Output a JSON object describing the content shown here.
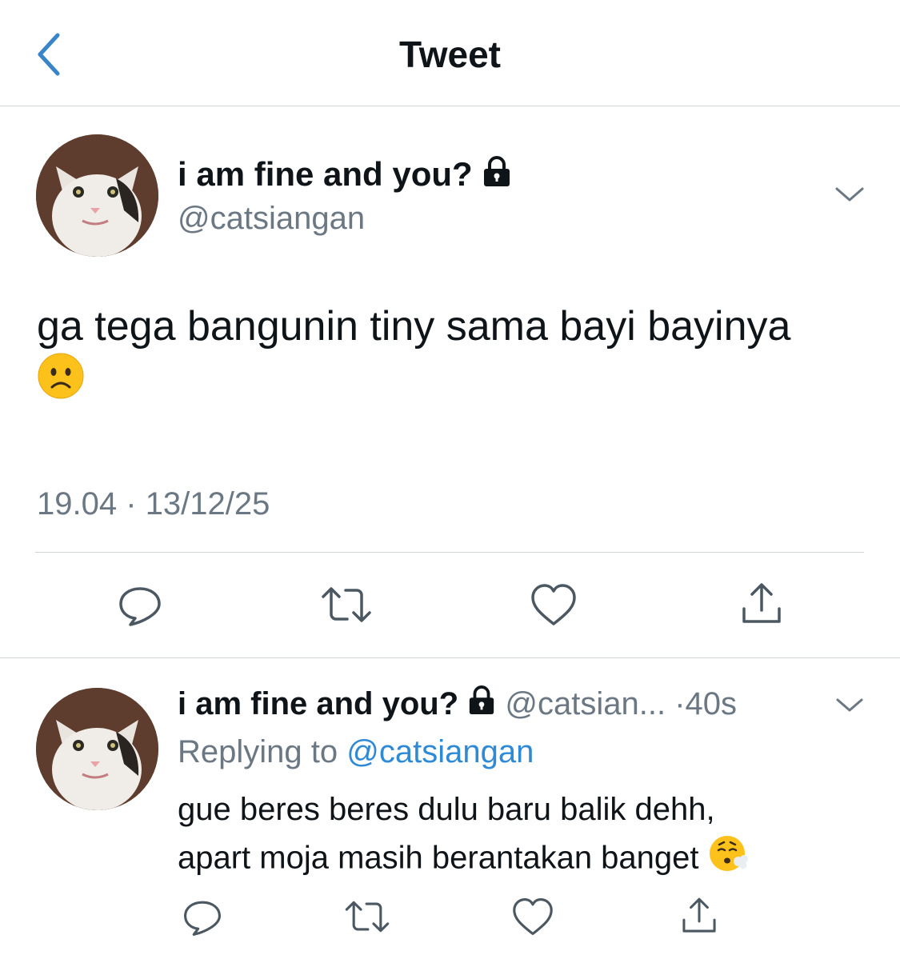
{
  "nav": {
    "title": "Tweet",
    "back_icon": "chevron-left-icon"
  },
  "tweet": {
    "display_name": "i am fine and you?",
    "handle": "@catsiangan",
    "text": "ga tega bangunin tiny sama bayi bayinya",
    "text_emoji": "frowning-face-emoji",
    "time": "19.04",
    "date": "13/12/25",
    "separator": "·",
    "protected_icon": "lock-icon",
    "menu_icon": "chevron-down-icon"
  },
  "actions": [
    "reply-icon",
    "retweet-icon",
    "like-icon",
    "share-icon"
  ],
  "reply": {
    "display_name": "i am fine and you?",
    "handle": "@catsian...",
    "age": "40s",
    "dot": "·",
    "replying_prefix": "Replying to",
    "replying_to": "@catsiangan",
    "text_line1": "gue beres beres dulu baru balik dehh,",
    "text_line2": "apart moja masih berantakan banget",
    "text_emoji": "face-exhaling-emoji",
    "menu_icon": "chevron-down-icon"
  },
  "colors": {
    "accent": "#3a85c8",
    "secondary_text": "#6b7884",
    "divider": "#cfd5db",
    "mention": "#2f8ad6"
  }
}
